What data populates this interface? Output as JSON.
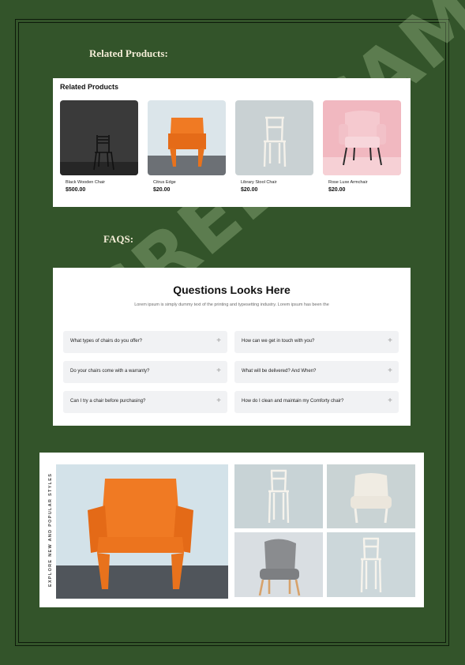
{
  "headings": {
    "related": "Related Products:",
    "faqs": "FAQS:"
  },
  "watermark": "GREENCAMPUS",
  "related": {
    "title": "Related Products",
    "products": [
      {
        "name": "Black Wooden Chair",
        "price": "$500.00"
      },
      {
        "name": "Citrus Edge",
        "price": "$20.00"
      },
      {
        "name": "Library Stool Chair",
        "price": "$20.00"
      },
      {
        "name": "Rose Luxe Armchair",
        "price": "$20.00"
      }
    ]
  },
  "faq": {
    "title": "Questions Looks Here",
    "subtitle": "Lorem ipsum is simply dummy text of the printing and typesetting industry. Lorem ipsum has been the",
    "items": [
      "What types of chairs do you offer?",
      "How can we get in touch with you?",
      "Do your chairs come with a warranty?",
      "What will be delivered? And When?",
      "Can I try a chair before purchasing?",
      "How do I clean and maintain my Comforty chair?"
    ],
    "plus": "+"
  },
  "gallery": {
    "side_label": "EXPLORE NEW AND POPULAR STYLES"
  },
  "colors": {
    "page": "#33542a",
    "heading": "#f3ecd6",
    "orange": "#f07a23"
  }
}
